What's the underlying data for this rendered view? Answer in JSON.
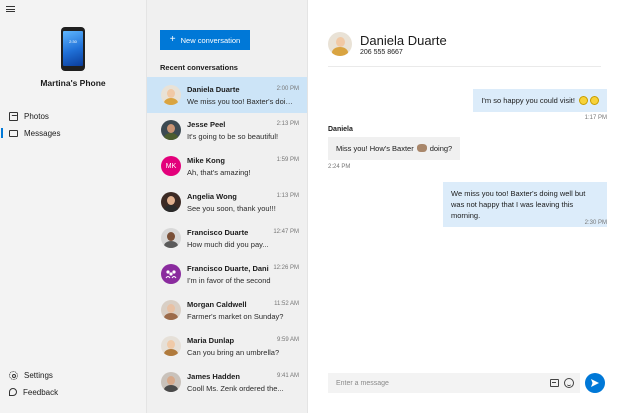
{
  "device": {
    "name": "Martina's Phone",
    "screen_time": "2:30"
  },
  "nav": {
    "items": [
      {
        "label": "Photos",
        "icon": "photo-icon"
      },
      {
        "label": "Messages",
        "icon": "message-icon",
        "active": true
      }
    ],
    "bottom": [
      {
        "label": "Settings",
        "icon": "gear-icon"
      },
      {
        "label": "Feedback",
        "icon": "feedback-icon"
      }
    ]
  },
  "list": {
    "new_button": "New conversation",
    "recent_label": "Recent conversations",
    "conversations": [
      {
        "name": "Daniela Duarte",
        "preview": "We miss you too! Baxter's doing ...",
        "time": "2:00 PM",
        "selected": true
      },
      {
        "name": "Jesse Peel",
        "preview": "It's going to be so beautiful!",
        "time": "2:13 PM"
      },
      {
        "name": "Mike Kong",
        "preview": "Ah, that's amazing!",
        "time": "1:59 PM",
        "initials": "MK"
      },
      {
        "name": "Angelia Wong",
        "preview": "See you soon, thank you!!!",
        "time": "1:13 PM"
      },
      {
        "name": "Francisco Duarte",
        "preview": "How much did you pay...",
        "time": "12:47 PM"
      },
      {
        "name": "Francisco Duarte, Dani...",
        "preview": "I'm in favor of the second",
        "time": "12:26 PM"
      },
      {
        "name": "Morgan Caldwell",
        "preview": "Farmer's market on Sunday?",
        "time": "11:52 AM"
      },
      {
        "name": "Maria Dunlap",
        "preview": "Can you bring an umbrella?",
        "time": "9:59 AM"
      },
      {
        "name": "James Hadden",
        "preview": "Cooll Ms. Zenk ordered the...",
        "time": "9:41 AM"
      }
    ]
  },
  "chat": {
    "contact_name": "Daniela Duarte",
    "contact_phone": "206 555 8667",
    "messages": [
      {
        "direction": "out",
        "text": "I'm so happy you could visit!",
        "time": "1:17 PM"
      },
      {
        "direction": "in",
        "sender": "Daniela",
        "text_before": "Miss you! How's Baxter",
        "text_after": "doing?",
        "time": "2:24 PM"
      },
      {
        "direction": "out",
        "text": "We miss you too! Baxter's doing well but was not happy that I was leaving this morning.",
        "time": "2:30 PM"
      }
    ],
    "compose_placeholder": "Enter a message"
  },
  "colors": {
    "accent": "#0078d7",
    "selected_row": "#cce4f7",
    "outgoing_bubble": "#dcecfa",
    "incoming_bubble": "#f0f0f0"
  }
}
